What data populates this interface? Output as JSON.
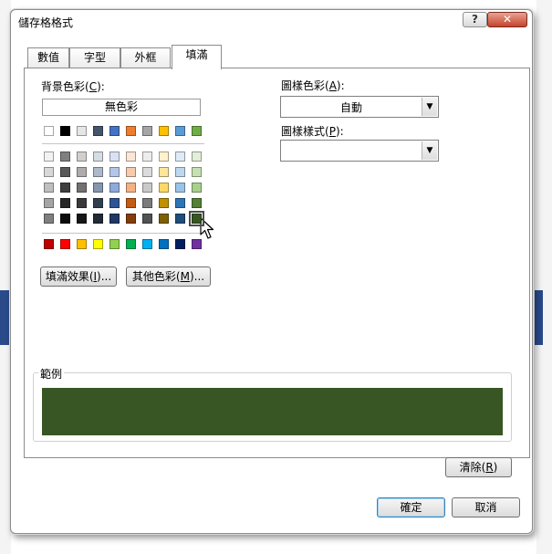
{
  "window": {
    "title": "儲存格格式"
  },
  "tabs": [
    {
      "label": "數值",
      "active": false
    },
    {
      "label": "字型",
      "active": false
    },
    {
      "label": "外框",
      "active": false
    },
    {
      "label": "填滿",
      "active": true
    }
  ],
  "fill": {
    "background_label_pre": "背景色彩(",
    "background_label_key": "C",
    "background_label_post": "):",
    "no_color_label": "無色彩",
    "theme_top_row": [
      "#ffffff",
      "#000000",
      "#e7e6e6",
      "#44546a",
      "#4472c4",
      "#ed7d31",
      "#a5a5a5",
      "#ffc000",
      "#5b9bd5",
      "#70ad47"
    ],
    "theme_shades": [
      [
        "#f2f2f2",
        "#7f7f7f",
        "#d0cece",
        "#d6dce4",
        "#d9e2f3",
        "#fbe5d5",
        "#ededed",
        "#fff2cc",
        "#deebf6",
        "#e2efd9"
      ],
      [
        "#d8d8d8",
        "#595959",
        "#aeabab",
        "#adb9ca",
        "#b4c6e7",
        "#f7caac",
        "#dbdbdb",
        "#fee599",
        "#bdd7ee",
        "#c5e0b3"
      ],
      [
        "#bfbfbf",
        "#3f3f3f",
        "#757070",
        "#8496b0",
        "#8eaadb",
        "#f4b183",
        "#c9c9c9",
        "#ffd965",
        "#9cc3e5",
        "#a8d08d"
      ],
      [
        "#a5a5a5",
        "#262626",
        "#3a3838",
        "#323f4f",
        "#2f5496",
        "#c55a11",
        "#7b7b7b",
        "#bf9000",
        "#2e75b5",
        "#538135"
      ],
      [
        "#7f7f7f",
        "#0c0c0c",
        "#171616",
        "#222a35",
        "#1f3864",
        "#833c0b",
        "#525252",
        "#7f6000",
        "#1e4e79",
        "#375623"
      ]
    ],
    "standard_colors": [
      "#c00000",
      "#ff0000",
      "#ffc000",
      "#ffff00",
      "#92d050",
      "#00b050",
      "#00b0f0",
      "#0070c0",
      "#002060",
      "#7030a0"
    ],
    "selected_color": "#375623",
    "fill_effects_pre": "填滿效果(",
    "fill_effects_key": "I",
    "fill_effects_post": ")...",
    "more_colors_pre": "其他色彩(",
    "more_colors_key": "M",
    "more_colors_post": ")...",
    "pattern_color_label_pre": "圖樣色彩(",
    "pattern_color_label_key": "A",
    "pattern_color_label_post": "):",
    "pattern_color_value": "自動",
    "pattern_style_label_pre": "圖樣樣式(",
    "pattern_style_label_key": "P",
    "pattern_style_label_post": "):",
    "pattern_style_value": "",
    "sample_label": "範例",
    "clear_pre": "清除(",
    "clear_key": "R",
    "clear_post": ")"
  },
  "footer": {
    "ok_label": "確定",
    "cancel_label": "取消"
  }
}
